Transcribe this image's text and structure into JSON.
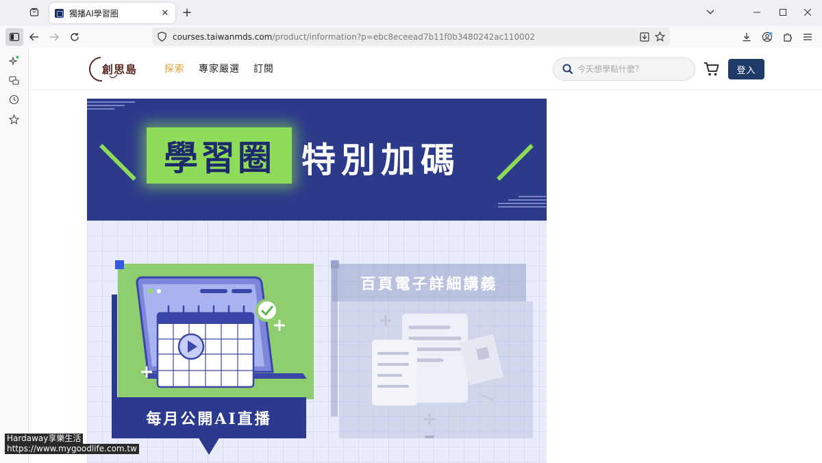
{
  "browser": {
    "tab_title": "獨播AI學習圈",
    "url_host": "courses.taiwanmds.com",
    "url_path": "/product/information?p=ebc8eceead7b11f0b3480242ac110002"
  },
  "site": {
    "logo_text": "創思島",
    "nav": [
      {
        "label": "探索",
        "active": true
      },
      {
        "label": "專家嚴選",
        "active": false
      },
      {
        "label": "訂閱",
        "active": false
      }
    ],
    "search_placeholder": "今天想學點什麼？",
    "login_label": "登入"
  },
  "banner": {
    "highlight": "學習圈",
    "headline_rest": "特別加碼",
    "card1_caption": "每月公開AI直播",
    "card2_caption": "百頁電子詳細講義"
  },
  "watermark": {
    "line1": "Hardaway享樂生活",
    "line2": "https://www.mygoodlife.com.tw"
  },
  "colors": {
    "brand_navy": "#2c3a8a",
    "accent_green": "#8fdc5a",
    "nav_active": "#e3a033",
    "login_button": "#1f3a68"
  }
}
